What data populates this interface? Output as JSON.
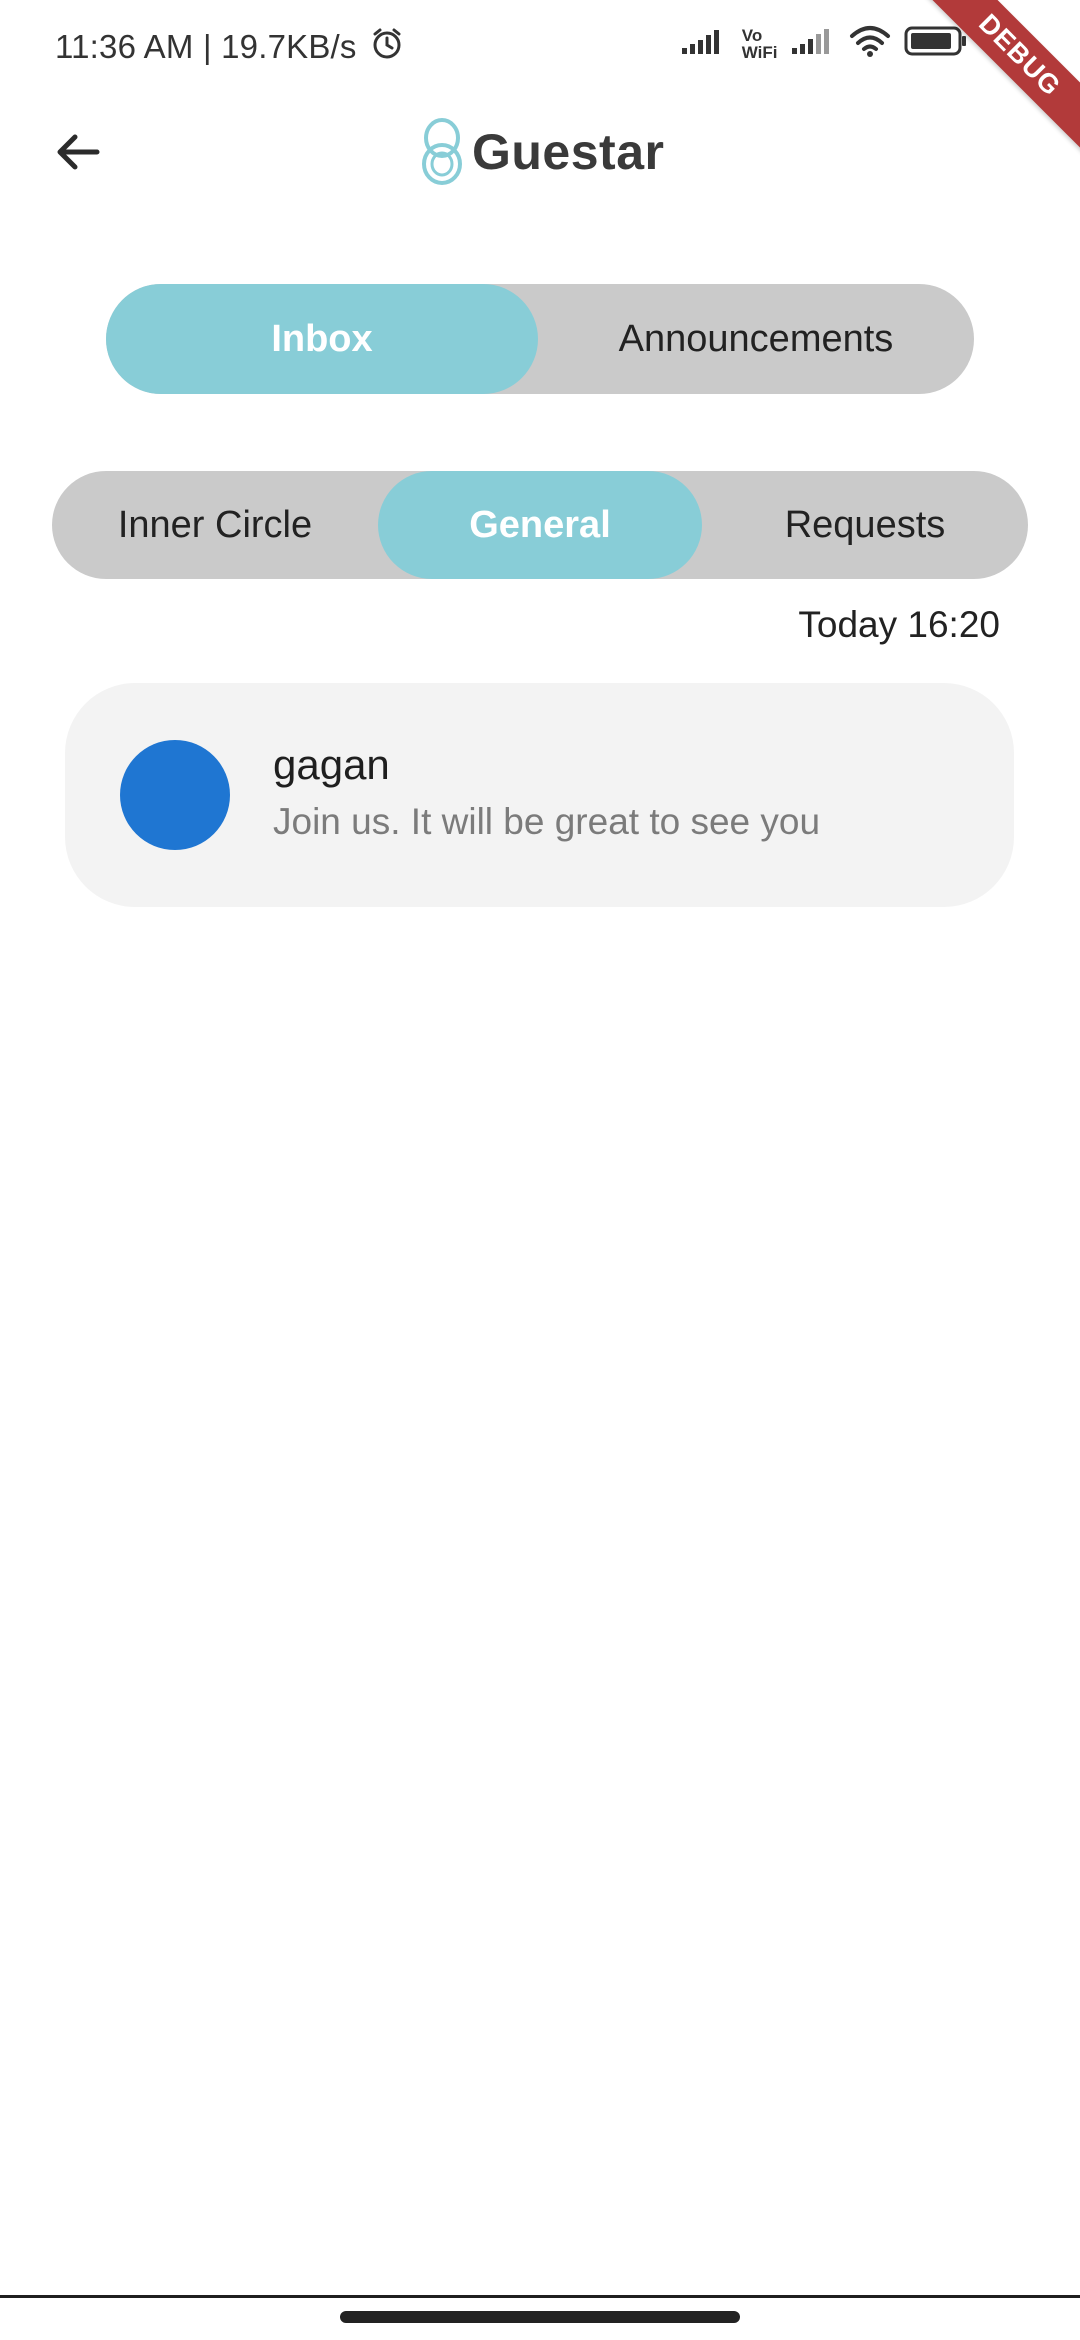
{
  "status_bar": {
    "time": "11:36 AM | 19.7KB/s",
    "vo_line1": "Vo",
    "vo_line2": "WiFi",
    "battery": "86"
  },
  "debug_banner": "DEBUG",
  "app_bar": {
    "brand_name": "Guestar"
  },
  "tabs": {
    "inbox": "Inbox",
    "announcements": "Announcements"
  },
  "subtabs": {
    "inner_circle": "Inner Circle",
    "general": "General",
    "requests": "Requests"
  },
  "messages": [
    {
      "timestamp": "Today 16:20",
      "sender": "gagan",
      "preview": "Join us. It will be great to see you"
    }
  ],
  "colors": {
    "accent": "#88cdd7",
    "avatar": "#1f76d2",
    "segment_bg": "#cacaca",
    "card_bg": "#f3f3f3",
    "debug": "#b23a3a"
  },
  "icons": {
    "back": "arrow-left-icon",
    "brand": "guestar-logo-icon",
    "alarm": "alarm-icon",
    "signal": "signal-icon",
    "wifi": "wifi-icon",
    "battery": "battery-icon"
  }
}
